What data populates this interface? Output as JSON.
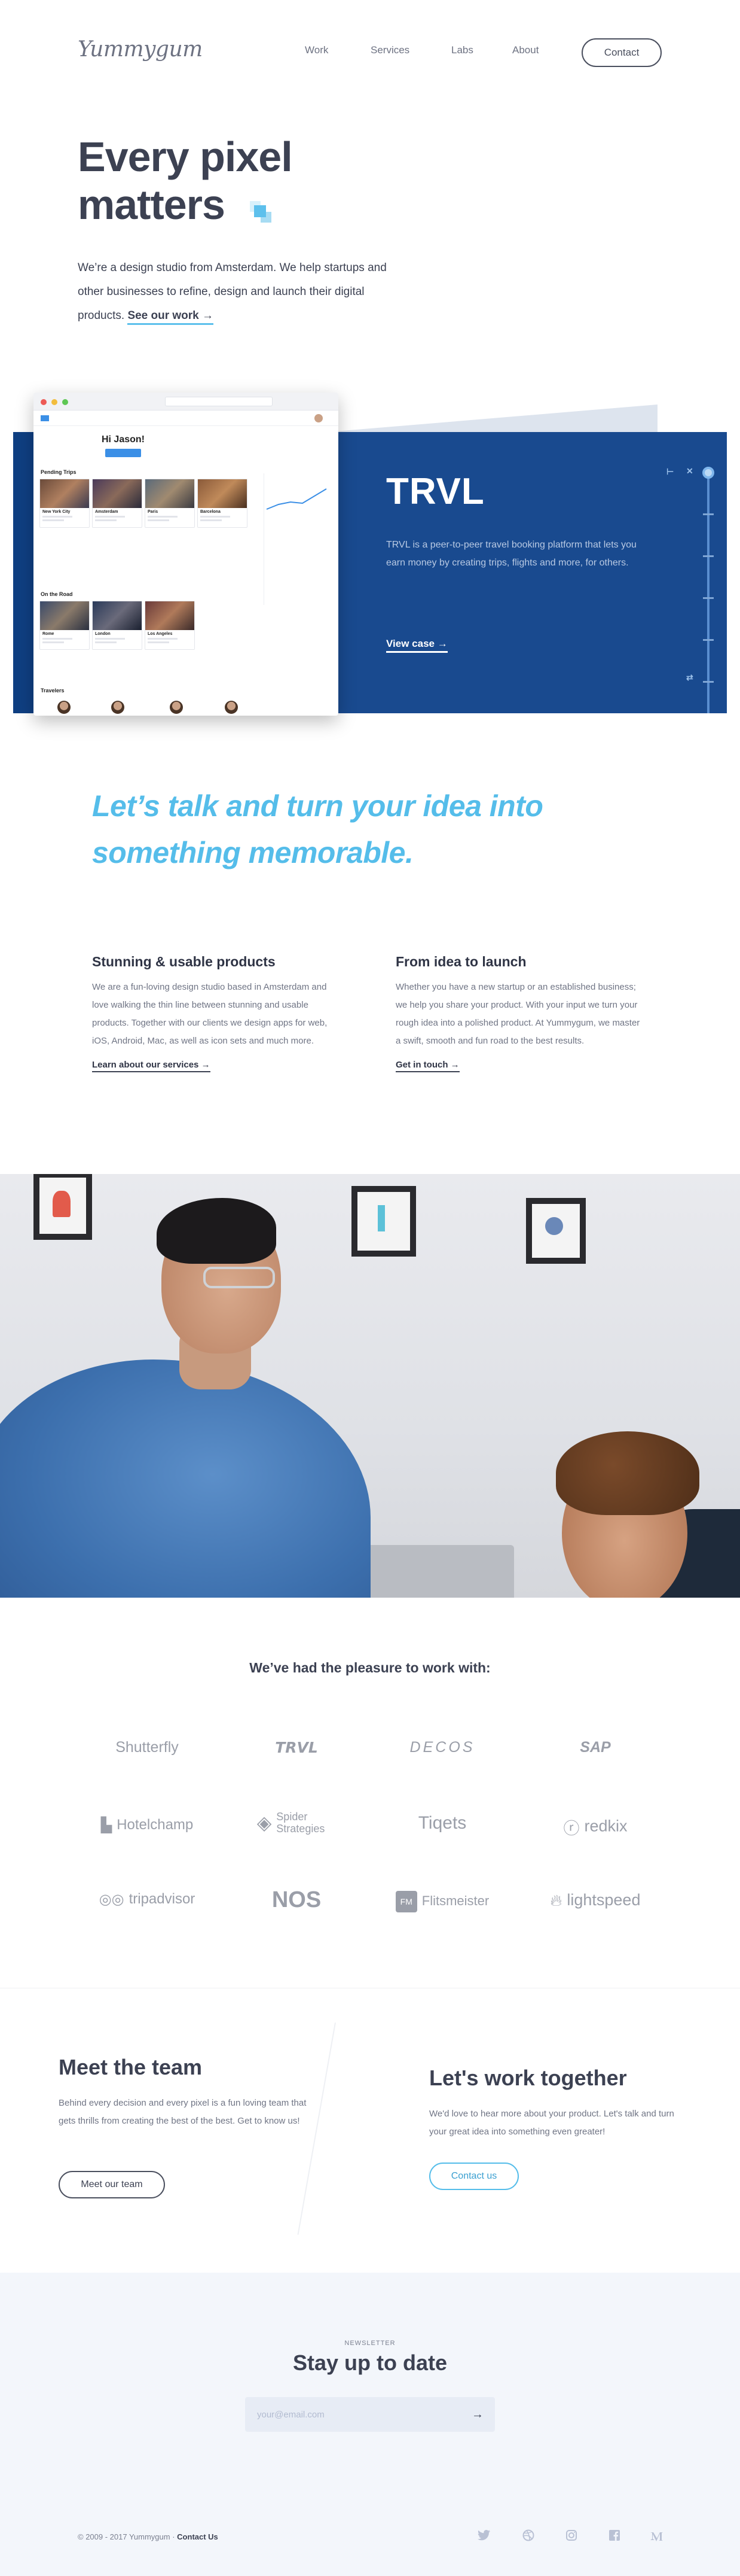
{
  "header": {
    "logo": "Yummygum",
    "nav": [
      "Work",
      "Services",
      "Labs",
      "About"
    ],
    "contact": "Contact"
  },
  "hero": {
    "title_line1": "Every pixel",
    "title_line2": "matters",
    "text": "We’re a design studio from Amsterdam. We help startups and other businesses to refine, design and launch their digital products.",
    "link": "See our work"
  },
  "case": {
    "title": "TRVL",
    "description": "TRVL is a peer-to-peer travel booking platform that lets you earn money by creating trips, flights and more, for others.",
    "link": "View case",
    "app": {
      "greeting": "Hi Jason!",
      "section_pending": "Pending Trips",
      "section_road": "On the Road",
      "section_travelers": "Travelers",
      "pending": [
        "New York City",
        "Amsterdam",
        "Paris",
        "Barcelona"
      ],
      "road": [
        "Rome",
        "London",
        "Los Angeles"
      ]
    }
  },
  "talk": {
    "line1": "Let’s talk and turn your idea into",
    "line2": "something memorable."
  },
  "services": {
    "left": {
      "title": "Stunning & usable products",
      "text": "We are a fun-loving design studio based in Amsterdam and love walking the thin line between stunning and usable products. Together with our clients we design apps for web, iOS, Android, Mac, as well as icon sets and much more.",
      "link": "Learn about our services"
    },
    "right": {
      "title": "From idea to launch",
      "text": "Whether you have a new startup or an established business; we help you share your product. With your input we turn your rough idea into a polished product. At Yummygum, we master a swift, smooth and fun road to the best results.",
      "link": "Get in touch"
    }
  },
  "clients": {
    "title": "We’ve had the pleasure to work with:",
    "logos": [
      "Shutterfly",
      "TRVL",
      "DECOS",
      "SAP",
      "Hotelchamp",
      "Spider Strategies",
      "Tiqets",
      "redkix",
      "tripadvisor",
      "NOS",
      "Flitsmeister",
      "lightspeed"
    ]
  },
  "team": {
    "title": "Meet the team",
    "text": "Behind every decision and every pixel is a fun loving team that gets thrills from creating the best of the best. Get to know us!",
    "button": "Meet our team"
  },
  "together": {
    "title": "Let's work together",
    "text": "We'd love to hear more about your product. Let's talk and turn your great idea into something even greater!",
    "button": "Contact us"
  },
  "newsletter": {
    "kicker": "NEWSLETTER",
    "title": "Stay up to date",
    "placeholder": "your@email.com"
  },
  "footer": {
    "copyright": "© 2009 - 2017 Yummygum ·",
    "contact": "Contact Us",
    "social": [
      "twitter-icon",
      "dribbble-icon",
      "instagram-icon",
      "facebook-icon",
      "medium-icon"
    ]
  },
  "colors": {
    "accent": "#55bdea",
    "case_blue": "#194a8f",
    "text_dark": "#3c4152"
  }
}
